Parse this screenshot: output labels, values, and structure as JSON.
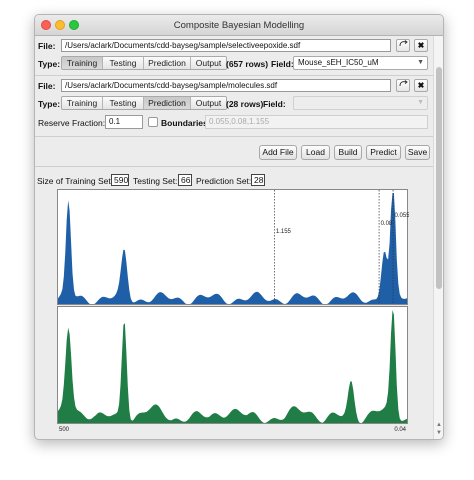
{
  "window": {
    "title": "Composite Bayesian Modelling"
  },
  "row1": {
    "file_label": "File:",
    "file_path": "/Users/aclark/Documents/cdd-bayseg/sample/selectiveepoxide.sdf",
    "open_icon": "curved-arrow-icon",
    "close_icon": "x-icon",
    "type_label": "Type:",
    "types": [
      "Training",
      "Testing",
      "Prediction",
      "Output"
    ],
    "selected_type": "Training",
    "rows_text": "(657 rows)",
    "field_label": "Field:",
    "field_value": "Mouse_sEH_IC50_uM"
  },
  "row2": {
    "file_label": "File:",
    "file_path": "/Users/aclark/Documents/cdd-bayseg/sample/molecules.sdf",
    "open_icon": "curved-arrow-icon",
    "close_icon": "x-icon",
    "type_label": "Type:",
    "types": [
      "Training",
      "Testing",
      "Prediction",
      "Output"
    ],
    "selected_type": "Prediction",
    "rows_text": "(28 rows)",
    "field_label": "Field:",
    "field_value": ""
  },
  "params": {
    "reserve_label": "Reserve Fraction:",
    "reserve_value": "0.1",
    "boundaries_label": "Boundaries:",
    "boundaries_placeholder": "0.055,0.08,1.155",
    "boundaries_checked": false
  },
  "actions": [
    "Add File",
    "Load",
    "Build",
    "Predict",
    "Save"
  ],
  "stats": {
    "training_label": "Size of Training Set:",
    "training_value": "590",
    "testing_label": "Testing Set:",
    "testing_value": "66",
    "prediction_label": "Prediction Set:",
    "prediction_value": "28"
  },
  "chart_data": {
    "type": "area",
    "x_axis_left_label": "500",
    "x_axis_right_label": "0.04",
    "boundaries": [
      {
        "label": "1.155",
        "position_fraction": 0.62
      },
      {
        "label": "0.08",
        "position_fraction": 0.92
      },
      {
        "label": "0.055",
        "position_fraction": 0.96
      }
    ],
    "series": [
      {
        "color": "#1f5fa8",
        "peaks": [
          {
            "x": 0.03,
            "height": 0.86
          },
          {
            "x": 0.19,
            "height": 0.42
          },
          {
            "x": 0.96,
            "height": 1.0
          },
          {
            "x": 0.935,
            "height": 0.45
          }
        ]
      },
      {
        "color": "#1f7d45",
        "peaks": [
          {
            "x": 0.03,
            "height": 0.76
          },
          {
            "x": 0.19,
            "height": 0.9
          },
          {
            "x": 0.96,
            "height": 0.92
          },
          {
            "x": 0.84,
            "height": 0.3
          }
        ]
      }
    ]
  },
  "colors": {
    "training_blue": "#1f5fa8",
    "prediction_green": "#1f7d45"
  },
  "icons": {
    "scroll_up": "triangle-up-icon",
    "scroll_down": "triangle-down-icon"
  }
}
